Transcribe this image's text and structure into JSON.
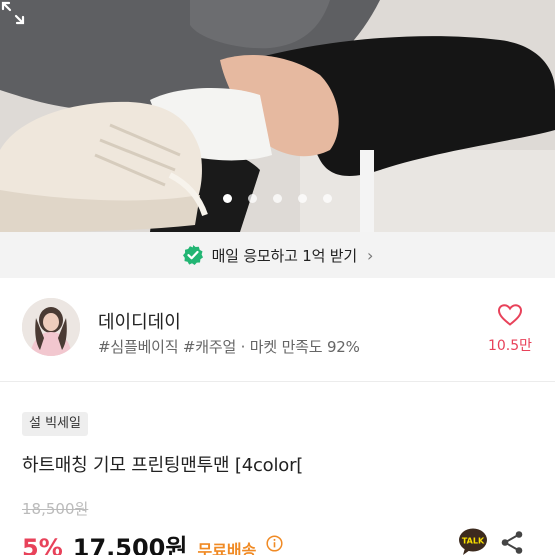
{
  "hero": {
    "image": "product-photo",
    "carousel": {
      "count": 5,
      "active_index": 0
    },
    "expand_icon": "expand-icon"
  },
  "promo": {
    "icon": "verified-check-icon",
    "text": "매일 응모하고 1억 받기",
    "chevron": "›"
  },
  "shop": {
    "name": "데이디데이",
    "tags": "#심플베이직 #캐주얼 · 마켓 만족도 92%",
    "favorite_icon": "heart-icon",
    "favorite_count": "10.5만"
  },
  "product": {
    "badge": "설 빅세일",
    "title": "하트매칭 기모 프린팅맨투맨 [4color[",
    "original_price": "18,500원",
    "discount": "5%",
    "price": "17,500원",
    "shipping": "무료배송",
    "info_icon": "info-icon",
    "talk_icon": "kakao-talk-icon",
    "share_icon": "share-icon"
  },
  "colors": {
    "accent": "#e8425a",
    "shipping": "#f08a24",
    "check": "#22b573"
  }
}
